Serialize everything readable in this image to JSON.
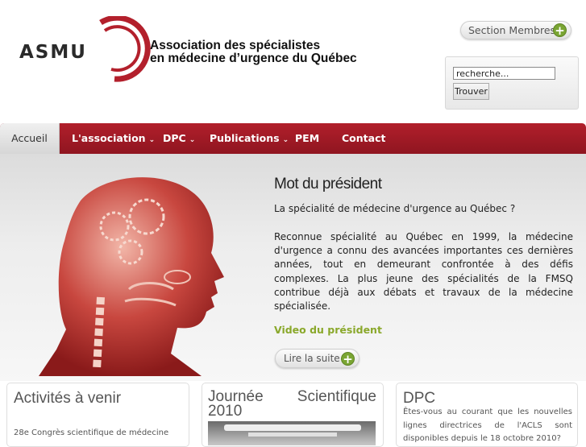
{
  "header": {
    "logo_text": "ASMU",
    "org_name_line1": "Association des spécialistes",
    "org_name_line2": "en médecine d’urgence du Québec",
    "members_button": "Section Membres",
    "search": {
      "placeholder": "recherche...",
      "button": "Trouver"
    }
  },
  "nav": {
    "items": [
      {
        "label": "Accueil",
        "active": true,
        "dropdown": false
      },
      {
        "label": "L'association",
        "active": false,
        "dropdown": true
      },
      {
        "label": "DPC",
        "active": false,
        "dropdown": true
      },
      {
        "label": "Publications",
        "active": false,
        "dropdown": true
      },
      {
        "label": "PEM",
        "active": false,
        "dropdown": false
      },
      {
        "label": "Contact",
        "active": false,
        "dropdown": false
      }
    ],
    "chevron": "⌄"
  },
  "hero": {
    "title": "Mot du président",
    "subtitle": "La spécialité de médecine d'urgence au Québec ?",
    "body": "Reconnue spécialité au Québec en 1999, la médecine d'urgence a connu des avancées importantes ces dernières années, tout en demeurant confrontée à des défis complexes. La plus jeune des spécialités de la FMSQ contribue déjà aux débats et travaux de la médecine spécialisée.",
    "video_link": "Video du président",
    "read_more": "Lire la suite"
  },
  "boxes": [
    {
      "title": "Activités à venir",
      "text": "28e Congrès scientifique de médecine"
    },
    {
      "title_left": "Journée",
      "title_right": "Scientifique",
      "title_line2": "2010"
    },
    {
      "title": "DPC",
      "text": "Êtes-vous au courant que les nouvelles lignes directrices de l'ACLS sont disponibles depuis le 18 octobre 2010?"
    }
  ],
  "colors": {
    "brand_red": "#a01a26",
    "accent_green": "#8aa82b",
    "plus_green": "#7aa533"
  },
  "icons": {
    "plus": "+"
  }
}
